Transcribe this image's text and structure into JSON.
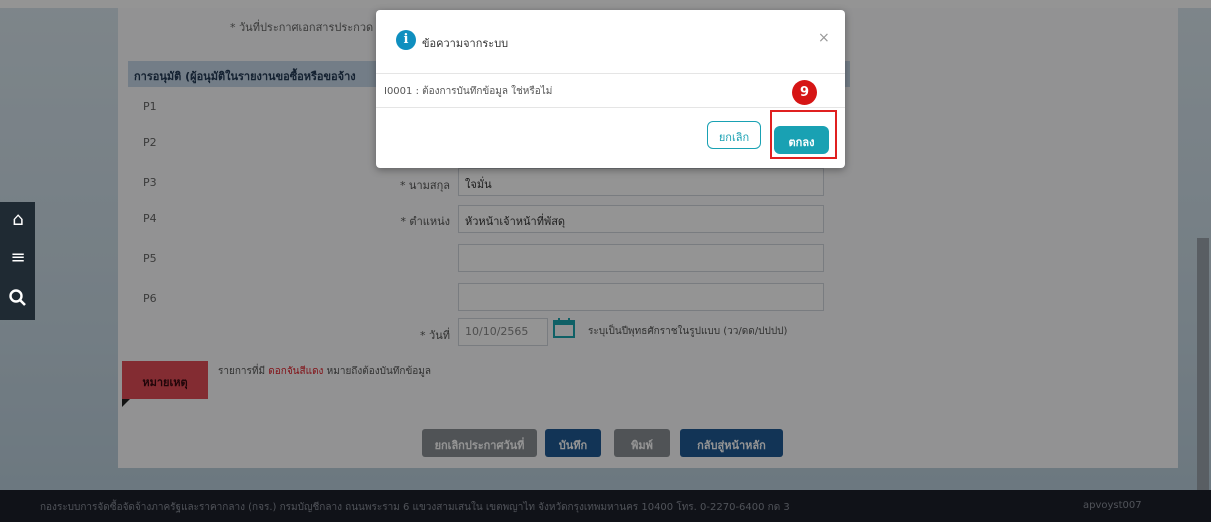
{
  "form": {
    "announce_label_partial": "* วันที่ประกาศเอกสารประกวด",
    "section_title": "การอนุมัติ (ผู้อนุมัติในรายงานขอซื้อหรือขอจ้าง",
    "rows": [
      {
        "code": "P1"
      },
      {
        "code": "P2"
      },
      {
        "code": "P3",
        "label": "* นามสกุล",
        "value": "ใจมั่น"
      },
      {
        "code": "P4",
        "label": "* ตำแหน่ง",
        "value": "หัวหน้าเจ้าหน้าที่พัสดุ"
      },
      {
        "code": "P5"
      },
      {
        "code": "P6"
      }
    ],
    "date_label": "* วันที่",
    "date_value": "10/10/2565",
    "date_hint": "ระบุเป็นปีพุทธศักราชในรูปแบบ (วว/ดด/ปปปป)",
    "note_tag": "หมายเหตุ",
    "note_text_prefix": "รายการที่มี",
    "note_text_red": "ดอกจันสีแดง",
    "note_text_suffix": "หมายถึงต้องบันทึกข้อมูล"
  },
  "buttons": {
    "cancel_announce": "ยกเลิกประกาศวันที่",
    "save": "บันทึก",
    "print": "พิมพ์",
    "back_home": "กลับสู่หน้าหลัก"
  },
  "sidebar": {
    "icons": [
      "home-icon",
      "menu-icon",
      "search-icon"
    ]
  },
  "footer": {
    "text": "กองระบบการจัดซื้อจัดจ้างภาครัฐและราคากลาง (กจร.) กรมบัญชีกลาง ถนนพระราม 6 แขวงสามเสนใน เขตพญาไท จังหวัดกรุงเทพมหานคร 10400 โทร. 0-2270-6400 กด 3",
    "user": "apvoyst007"
  },
  "modal": {
    "title": "ข้อความจากระบบ",
    "message": "I0001 : ต้องการบันทึกข้อมูล ใช่หรือไม่",
    "close": "×",
    "cancel_label": "ยกเลิก",
    "ok_label": "ตกลง"
  },
  "annotation": {
    "step": "9"
  },
  "colors": {
    "accent": "#19a1b3",
    "highlight": "#e02020",
    "badge": "#d61515",
    "btn_dark": "#1f5a94",
    "note_red": "#e24d57"
  }
}
